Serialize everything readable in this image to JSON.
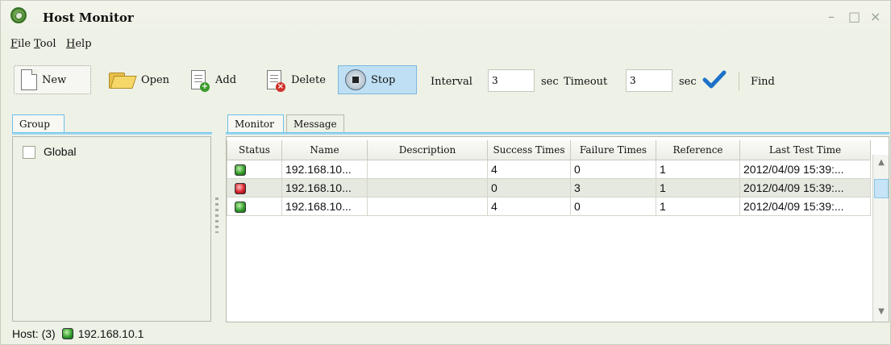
{
  "window": {
    "title": "Host Monitor",
    "controls": {
      "minimize": "–",
      "maximize": "□",
      "close": "×"
    }
  },
  "menu": {
    "items": [
      {
        "accel": "F",
        "rest": "ile"
      },
      {
        "accel": "T",
        "rest": "ool"
      },
      {
        "accel": "H",
        "rest": "elp"
      }
    ]
  },
  "toolbar": {
    "new_label": "New",
    "open_label": "Open",
    "add_label": "Add",
    "delete_label": "Delete",
    "stop_label": "Stop",
    "interval_label": "Interval",
    "interval_value": "3",
    "interval_unit": "sec",
    "timeout_label": "Timeout",
    "timeout_value": "3",
    "timeout_unit": "sec",
    "find_label": "Find",
    "icons": {
      "new": "new-document-icon",
      "open": "folder-icon",
      "add": "add-sheet-icon",
      "delete": "delete-sheet-icon",
      "stop": "stop-icon",
      "apply": "checkmark-icon"
    }
  },
  "group_panel": {
    "tab_label": "Group",
    "items": [
      {
        "label": "Global",
        "checked": false
      }
    ]
  },
  "monitor": {
    "tabs": [
      {
        "label": "Monitor",
        "active": true
      },
      {
        "label": "Message",
        "active": false
      }
    ],
    "columns": [
      "Status",
      "Name",
      "Description",
      "Success Times",
      "Failure Times",
      "Reference",
      "Last Test Time"
    ],
    "rows": [
      {
        "status": "green",
        "name": "192.168.10...",
        "description": "",
        "success": "4",
        "failure": "0",
        "reference": "1",
        "last_test": "2012/04/09 15:39:..."
      },
      {
        "status": "red",
        "name": "192.168.10...",
        "description": "",
        "success": "0",
        "failure": "3",
        "reference": "1",
        "last_test": "2012/04/09 15:39:..."
      },
      {
        "status": "green",
        "name": "192.168.10...",
        "description": "",
        "success": "4",
        "failure": "0",
        "reference": "1",
        "last_test": "2012/04/09 15:39:..."
      }
    ]
  },
  "status_bar": {
    "host_label": "Host: (3)",
    "host_status": "green",
    "host_ip": "192.168.10.1"
  },
  "colors": {
    "status_green": "#2f9a2a",
    "status_red": "#d41e2a",
    "accent_blue": "#6ec0e8",
    "check_blue": "#1d72c8"
  }
}
